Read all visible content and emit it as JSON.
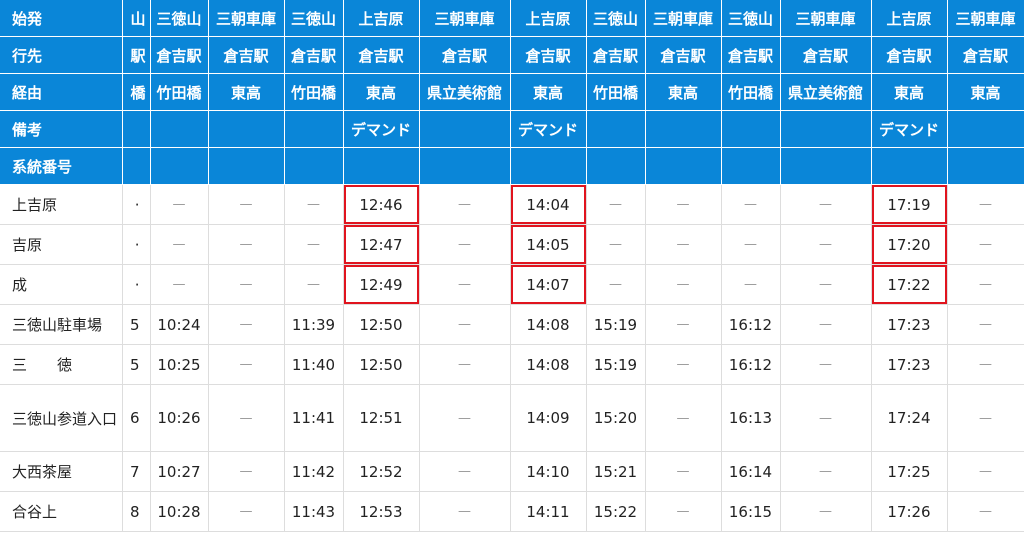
{
  "header_rows": [
    {
      "label": "始発",
      "cells": [
        "山",
        "三徳山",
        "三朝車庫",
        "三徳山",
        "上吉原",
        "三朝車庫",
        "上吉原",
        "三徳山",
        "三朝車庫",
        "三徳山",
        "三朝車庫",
        "上吉原",
        "三朝車庫"
      ]
    },
    {
      "label": "行先",
      "cells": [
        "駅",
        "倉吉駅",
        "倉吉駅",
        "倉吉駅",
        "倉吉駅",
        "倉吉駅",
        "倉吉駅",
        "倉吉駅",
        "倉吉駅",
        "倉吉駅",
        "倉吉駅",
        "倉吉駅",
        "倉吉駅"
      ]
    },
    {
      "label": "経由",
      "cells": [
        "橋",
        "竹田橋",
        "東高",
        "竹田橋",
        "東高",
        "県立美術館",
        "東高",
        "竹田橋",
        "東高",
        "竹田橋",
        "県立美術館",
        "東高",
        "東高"
      ]
    },
    {
      "label": "備考",
      "cells": [
        "",
        "",
        "",
        "",
        "デマンド",
        "",
        "デマンド",
        "",
        "",
        "",
        "",
        "デマンド",
        ""
      ]
    },
    {
      "label": "系統番号",
      "cells": [
        "",
        "",
        "",
        "",
        "",
        "",
        "",
        "",
        "",
        "",
        "",
        "",
        ""
      ]
    }
  ],
  "data_rows": [
    {
      "label": "上吉原",
      "cells": [
        "·",
        "—",
        "—",
        "—",
        "12:46",
        "—",
        "14:04",
        "—",
        "—",
        "—",
        "—",
        "17:19",
        "—"
      ]
    },
    {
      "label": "吉原",
      "cells": [
        "·",
        "—",
        "—",
        "—",
        "12:47",
        "—",
        "14:05",
        "—",
        "—",
        "—",
        "—",
        "17:20",
        "—"
      ]
    },
    {
      "label": "成",
      "cells": [
        "·",
        "—",
        "—",
        "—",
        "12:49",
        "—",
        "14:07",
        "—",
        "—",
        "—",
        "—",
        "17:22",
        "—"
      ]
    },
    {
      "label": "三徳山駐車場",
      "cells": [
        "5",
        "10:24",
        "—",
        "11:39",
        "12:50",
        "—",
        "14:08",
        "15:19",
        "—",
        "16:12",
        "—",
        "17:23",
        "—"
      ]
    },
    {
      "label": "三　　徳",
      "cells": [
        "5",
        "10:25",
        "—",
        "11:40",
        "12:50",
        "—",
        "14:08",
        "15:19",
        "—",
        "16:12",
        "—",
        "17:23",
        "—"
      ]
    },
    {
      "label": "三徳山参道入口",
      "cells": [
        "6",
        "10:26",
        "—",
        "11:41",
        "12:51",
        "—",
        "14:09",
        "15:20",
        "—",
        "16:13",
        "—",
        "17:24",
        "—"
      ]
    },
    {
      "label": "大西茶屋",
      "cells": [
        "7",
        "10:27",
        "—",
        "11:42",
        "12:52",
        "—",
        "14:10",
        "15:21",
        "—",
        "16:14",
        "—",
        "17:25",
        "—"
      ]
    },
    {
      "label": "合谷上",
      "cells": [
        "8",
        "10:28",
        "—",
        "11:43",
        "12:53",
        "—",
        "14:11",
        "15:22",
        "—",
        "16:15",
        "—",
        "17:26",
        "—"
      ]
    }
  ],
  "highlighted_columns": [
    5,
    7,
    12
  ],
  "highlighted_rows": [
    0,
    1,
    2
  ],
  "colors": {
    "header_bg": "#0a86d8",
    "header_text": "#ffffff",
    "highlight_border": "#e0141e",
    "grid": "#dddddd"
  }
}
